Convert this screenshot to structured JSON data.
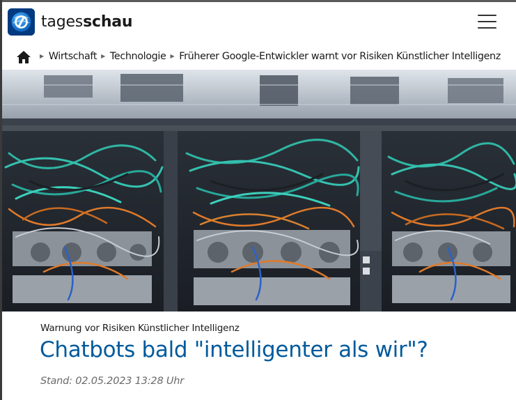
{
  "brand": {
    "name_light": "tages",
    "name_bold": "schau",
    "logo_icon": "tagesschau-globe-logo",
    "color": "#013a80"
  },
  "header": {
    "menu_icon": "hamburger-menu-icon"
  },
  "breadcrumb": {
    "home_icon": "home-icon",
    "items": [
      {
        "label": "Wirtschaft"
      },
      {
        "label": "Technologie"
      },
      {
        "label": "Früherer Google-Entwickler warnt vor Risiken Künstlicher Intelligenz"
      }
    ]
  },
  "hero": {
    "image": "Photo of server racks with blue, orange and grey network cables"
  },
  "article": {
    "kicker": "Warnung vor Risiken Künstlicher Intelligenz",
    "headline": "Chatbots bald \"intelligenter als wir\"?",
    "stand": "Stand: 02.05.2023 13:28 Uhr",
    "headline_color": "#005a9c"
  }
}
